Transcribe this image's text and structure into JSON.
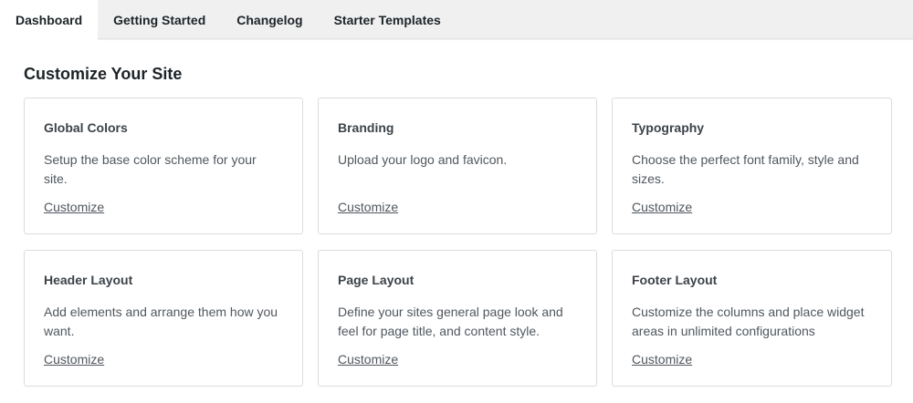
{
  "tabs": [
    {
      "label": "Dashboard",
      "active": true
    },
    {
      "label": "Getting Started",
      "active": false
    },
    {
      "label": "Changelog",
      "active": false
    },
    {
      "label": "Starter Templates",
      "active": false
    }
  ],
  "page_title": "Customize Your Site",
  "cards": [
    {
      "title": "Global Colors",
      "description": "Setup the base color scheme for your site.",
      "link": "Customize"
    },
    {
      "title": "Branding",
      "description": "Upload your logo and favicon.",
      "link": "Customize"
    },
    {
      "title": "Typography",
      "description": "Choose the perfect font family, style and sizes.",
      "link": "Customize"
    },
    {
      "title": "Header Layout",
      "description": "Add elements and arrange them how you want.",
      "link": "Customize"
    },
    {
      "title": "Page Layout",
      "description": "Define your sites general page look and feel for page title, and content style.",
      "link": "Customize"
    },
    {
      "title": "Footer Layout",
      "description": "Customize the columns and place widget areas in unlimited configurations",
      "link": "Customize"
    }
  ]
}
